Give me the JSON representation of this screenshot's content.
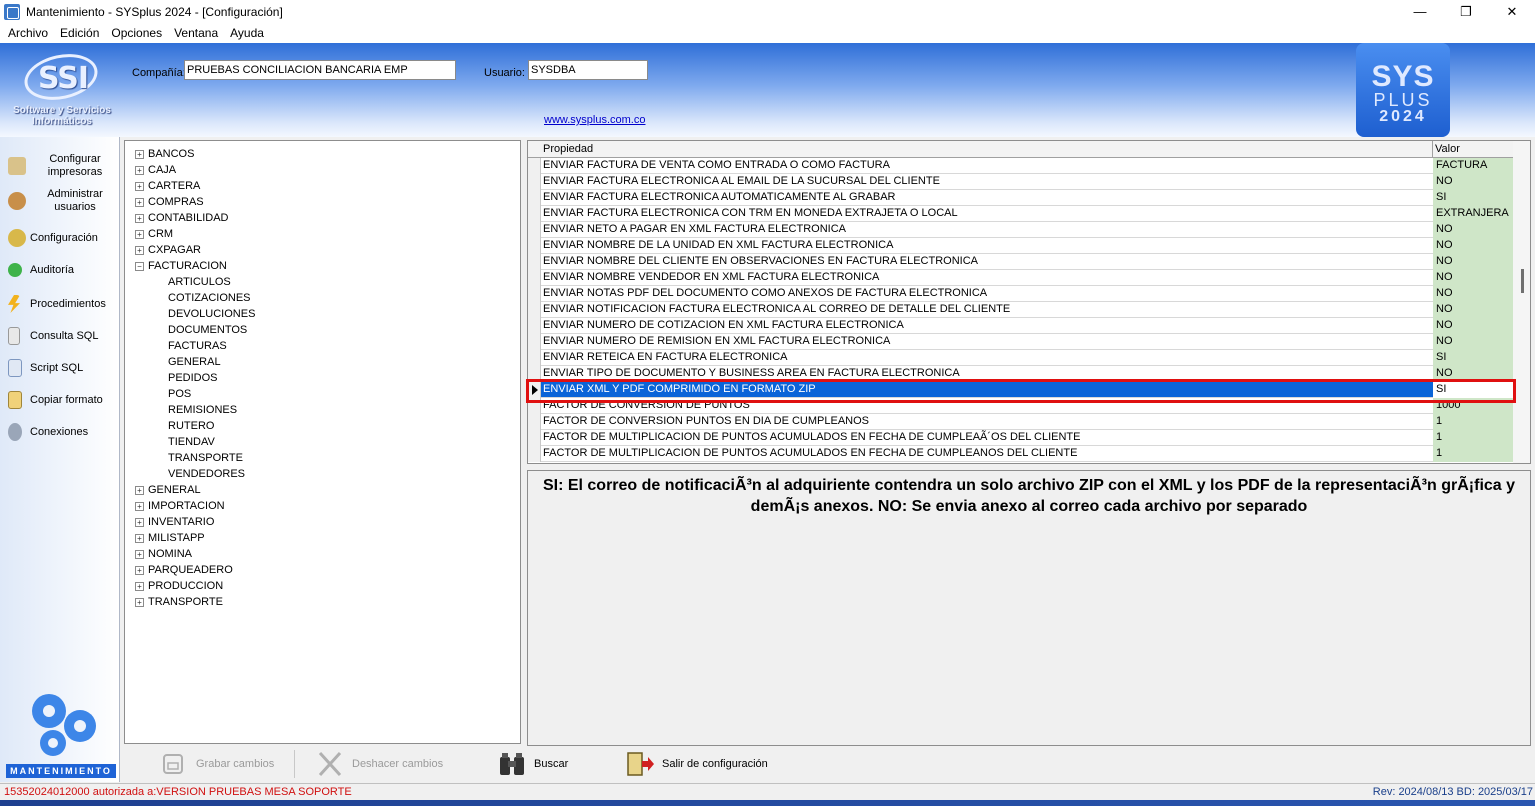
{
  "window": {
    "title": "Mantenimiento - SYSplus 2024 - [Configuración]",
    "minimize": "—",
    "restore": "❐",
    "close": "✕"
  },
  "menu": [
    "Archivo",
    "Edición",
    "Opciones",
    "Ventana",
    "Ayuda"
  ],
  "header": {
    "logo_text": "SSI",
    "logo_sub": "Software y Servicios Informáticos",
    "company_label": "Compañía:",
    "company_value": "PRUEBAS CONCILIACION BANCARIA EMP",
    "user_label": "Usuario:",
    "user_value": "SYSDBA",
    "website": "www.sysplus.com.co",
    "brand_l1": "SYS",
    "brand_l2": "PLUS",
    "brand_l3": "2024"
  },
  "left_panel": {
    "items": [
      {
        "label": "Configurar impresoras",
        "icon": "printer-icon"
      },
      {
        "label": "Administrar usuarios",
        "icon": "users-icon"
      },
      {
        "label": "Configuración",
        "icon": "gear-icon"
      },
      {
        "label": "Auditoría",
        "icon": "check-icon"
      },
      {
        "label": "Procedimientos",
        "icon": "lightning-icon"
      },
      {
        "label": "Consulta SQL",
        "icon": "document-icon"
      },
      {
        "label": "Script SQL",
        "icon": "script-icon"
      },
      {
        "label": "Copiar formato",
        "icon": "copy-icon"
      },
      {
        "label": "Conexiones",
        "icon": "connection-icon"
      }
    ],
    "footer": "MANTENIMIENTO"
  },
  "tree": {
    "top": [
      "BANCOS",
      "CAJA",
      "CARTERA",
      "COMPRAS",
      "CONTABILIDAD",
      "CRM",
      "CXPAGAR"
    ],
    "expanded": "FACTURACION",
    "children": [
      "ARTICULOS",
      "COTIZACIONES",
      "DEVOLUCIONES",
      "DOCUMENTOS",
      "FACTURAS",
      "GENERAL",
      "PEDIDOS",
      "POS",
      "REMISIONES",
      "RUTERO",
      "TIENDAV",
      "TRANSPORTE",
      "VENDEDORES"
    ],
    "bottom": [
      "GENERAL",
      "IMPORTACION",
      "INVENTARIO",
      "MILISTAPP",
      "NOMINA",
      "PARQUEADERO",
      "PRODUCCION",
      "TRANSPORTE"
    ]
  },
  "grid": {
    "header_prop": "Propiedad",
    "header_val": "Valor",
    "selected_index": 14,
    "rows": [
      {
        "prop": "ENVIAR FACTURA DE VENTA COMO ENTRADA O COMO FACTURA",
        "val": "FACTURA"
      },
      {
        "prop": "ENVIAR FACTURA ELECTRONICA AL EMAIL DE LA SUCURSAL DEL CLIENTE",
        "val": "NO"
      },
      {
        "prop": "ENVIAR FACTURA ELECTRONICA AUTOMATICAMENTE AL GRABAR",
        "val": "SI"
      },
      {
        "prop": "ENVIAR FACTURA ELECTRONICA CON TRM EN MONEDA EXTRAJETA O LOCAL",
        "val": "EXTRANJERA"
      },
      {
        "prop": "ENVIAR NETO A PAGAR EN XML FACTURA ELECTRONICA",
        "val": "NO"
      },
      {
        "prop": "ENVIAR NOMBRE DE LA UNIDAD EN XML FACTURA ELECTRONICA",
        "val": "NO"
      },
      {
        "prop": "ENVIAR NOMBRE DEL CLIENTE EN OBSERVACIONES EN FACTURA ELECTRONICA",
        "val": "NO"
      },
      {
        "prop": "ENVIAR NOMBRE VENDEDOR EN XML FACTURA ELECTRONICA",
        "val": "NO"
      },
      {
        "prop": "ENVIAR NOTAS PDF DEL DOCUMENTO COMO ANEXOS DE FACTURA ELECTRONICA",
        "val": "NO"
      },
      {
        "prop": "ENVIAR NOTIFICACION FACTURA ELECTRONICA AL CORREO DE DETALLE DEL CLIENTE",
        "val": "NO"
      },
      {
        "prop": "ENVIAR NUMERO DE COTIZACION EN XML FACTURA ELECTRONICA",
        "val": "NO"
      },
      {
        "prop": "ENVIAR NUMERO DE REMISION EN XML FACTURA ELECTRONICA",
        "val": "NO"
      },
      {
        "prop": "ENVIAR RETEICA EN FACTURA ELECTRONICA",
        "val": "SI"
      },
      {
        "prop": "ENVIAR TIPO DE DOCUMENTO Y BUSINESS AREA EN FACTURA ELECTRONICA",
        "val": "NO"
      },
      {
        "prop": "ENVIAR XML Y PDF COMPRIMIDO EN FORMATO ZIP",
        "val": "SI"
      },
      {
        "prop": "FACTOR DE CONVERSION DE PUNTOS",
        "val": "1000"
      },
      {
        "prop": "FACTOR DE CONVERSION PUNTOS EN DIA DE CUMPLEANOS",
        "val": "1"
      },
      {
        "prop": "FACTOR DE MULTIPLICACION DE PUNTOS ACUMULADOS EN FECHA DE CUMPLEAÃ´OS DEL CLIENTE",
        "val": "1"
      },
      {
        "prop": "FACTOR DE MULTIPLICACION DE PUNTOS ACUMULADOS EN FECHA DE CUMPLEANOS DEL CLIENTE",
        "val": "1"
      }
    ]
  },
  "description": "SI: El correo de notificaciÃ³n al adquiriente contendra un solo archivo ZIP con el XML y los PDF de la representaciÃ³n grÃ¡fica y demÃ¡s anexos. NO: Se envia anexo al correo cada archivo por separado",
  "toolbar": {
    "save": "Grabar cambios",
    "undo": "Deshacer cambios",
    "search": "Buscar",
    "exit": "Salir de configuración"
  },
  "status": {
    "left": "15352024012000 autorizada a:VERSION PRUEBAS MESA SOPORTE",
    "right": "Rev: 2024/08/13 BD: 2025/03/17"
  },
  "colors": {
    "selection": "#0a64d8",
    "value_bg": "#cfe6c8",
    "highlight": "#e01010",
    "status_red": "#d01010"
  }
}
